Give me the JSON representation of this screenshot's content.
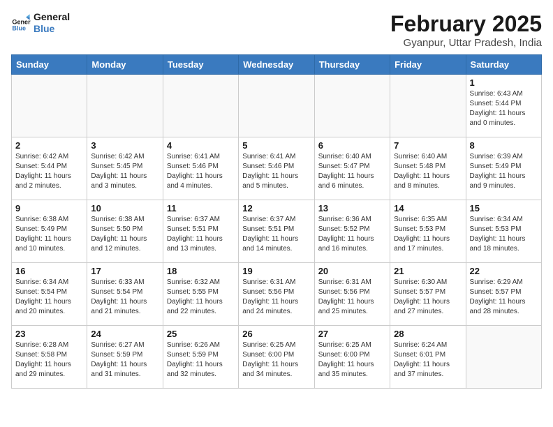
{
  "logo": {
    "text_general": "General",
    "text_blue": "Blue"
  },
  "title": "February 2025",
  "subtitle": "Gyanpur, Uttar Pradesh, India",
  "days_of_week": [
    "Sunday",
    "Monday",
    "Tuesday",
    "Wednesday",
    "Thursday",
    "Friday",
    "Saturday"
  ],
  "weeks": [
    [
      {
        "day": "",
        "info": ""
      },
      {
        "day": "",
        "info": ""
      },
      {
        "day": "",
        "info": ""
      },
      {
        "day": "",
        "info": ""
      },
      {
        "day": "",
        "info": ""
      },
      {
        "day": "",
        "info": ""
      },
      {
        "day": "1",
        "info": "Sunrise: 6:43 AM\nSunset: 5:44 PM\nDaylight: 11 hours\nand 0 minutes."
      }
    ],
    [
      {
        "day": "2",
        "info": "Sunrise: 6:42 AM\nSunset: 5:44 PM\nDaylight: 11 hours\nand 2 minutes."
      },
      {
        "day": "3",
        "info": "Sunrise: 6:42 AM\nSunset: 5:45 PM\nDaylight: 11 hours\nand 3 minutes."
      },
      {
        "day": "4",
        "info": "Sunrise: 6:41 AM\nSunset: 5:46 PM\nDaylight: 11 hours\nand 4 minutes."
      },
      {
        "day": "5",
        "info": "Sunrise: 6:41 AM\nSunset: 5:46 PM\nDaylight: 11 hours\nand 5 minutes."
      },
      {
        "day": "6",
        "info": "Sunrise: 6:40 AM\nSunset: 5:47 PM\nDaylight: 11 hours\nand 6 minutes."
      },
      {
        "day": "7",
        "info": "Sunrise: 6:40 AM\nSunset: 5:48 PM\nDaylight: 11 hours\nand 8 minutes."
      },
      {
        "day": "8",
        "info": "Sunrise: 6:39 AM\nSunset: 5:49 PM\nDaylight: 11 hours\nand 9 minutes."
      }
    ],
    [
      {
        "day": "9",
        "info": "Sunrise: 6:38 AM\nSunset: 5:49 PM\nDaylight: 11 hours\nand 10 minutes."
      },
      {
        "day": "10",
        "info": "Sunrise: 6:38 AM\nSunset: 5:50 PM\nDaylight: 11 hours\nand 12 minutes."
      },
      {
        "day": "11",
        "info": "Sunrise: 6:37 AM\nSunset: 5:51 PM\nDaylight: 11 hours\nand 13 minutes."
      },
      {
        "day": "12",
        "info": "Sunrise: 6:37 AM\nSunset: 5:51 PM\nDaylight: 11 hours\nand 14 minutes."
      },
      {
        "day": "13",
        "info": "Sunrise: 6:36 AM\nSunset: 5:52 PM\nDaylight: 11 hours\nand 16 minutes."
      },
      {
        "day": "14",
        "info": "Sunrise: 6:35 AM\nSunset: 5:53 PM\nDaylight: 11 hours\nand 17 minutes."
      },
      {
        "day": "15",
        "info": "Sunrise: 6:34 AM\nSunset: 5:53 PM\nDaylight: 11 hours\nand 18 minutes."
      }
    ],
    [
      {
        "day": "16",
        "info": "Sunrise: 6:34 AM\nSunset: 5:54 PM\nDaylight: 11 hours\nand 20 minutes."
      },
      {
        "day": "17",
        "info": "Sunrise: 6:33 AM\nSunset: 5:54 PM\nDaylight: 11 hours\nand 21 minutes."
      },
      {
        "day": "18",
        "info": "Sunrise: 6:32 AM\nSunset: 5:55 PM\nDaylight: 11 hours\nand 22 minutes."
      },
      {
        "day": "19",
        "info": "Sunrise: 6:31 AM\nSunset: 5:56 PM\nDaylight: 11 hours\nand 24 minutes."
      },
      {
        "day": "20",
        "info": "Sunrise: 6:31 AM\nSunset: 5:56 PM\nDaylight: 11 hours\nand 25 minutes."
      },
      {
        "day": "21",
        "info": "Sunrise: 6:30 AM\nSunset: 5:57 PM\nDaylight: 11 hours\nand 27 minutes."
      },
      {
        "day": "22",
        "info": "Sunrise: 6:29 AM\nSunset: 5:57 PM\nDaylight: 11 hours\nand 28 minutes."
      }
    ],
    [
      {
        "day": "23",
        "info": "Sunrise: 6:28 AM\nSunset: 5:58 PM\nDaylight: 11 hours\nand 29 minutes."
      },
      {
        "day": "24",
        "info": "Sunrise: 6:27 AM\nSunset: 5:59 PM\nDaylight: 11 hours\nand 31 minutes."
      },
      {
        "day": "25",
        "info": "Sunrise: 6:26 AM\nSunset: 5:59 PM\nDaylight: 11 hours\nand 32 minutes."
      },
      {
        "day": "26",
        "info": "Sunrise: 6:25 AM\nSunset: 6:00 PM\nDaylight: 11 hours\nand 34 minutes."
      },
      {
        "day": "27",
        "info": "Sunrise: 6:25 AM\nSunset: 6:00 PM\nDaylight: 11 hours\nand 35 minutes."
      },
      {
        "day": "28",
        "info": "Sunrise: 6:24 AM\nSunset: 6:01 PM\nDaylight: 11 hours\nand 37 minutes."
      },
      {
        "day": "",
        "info": ""
      }
    ]
  ]
}
